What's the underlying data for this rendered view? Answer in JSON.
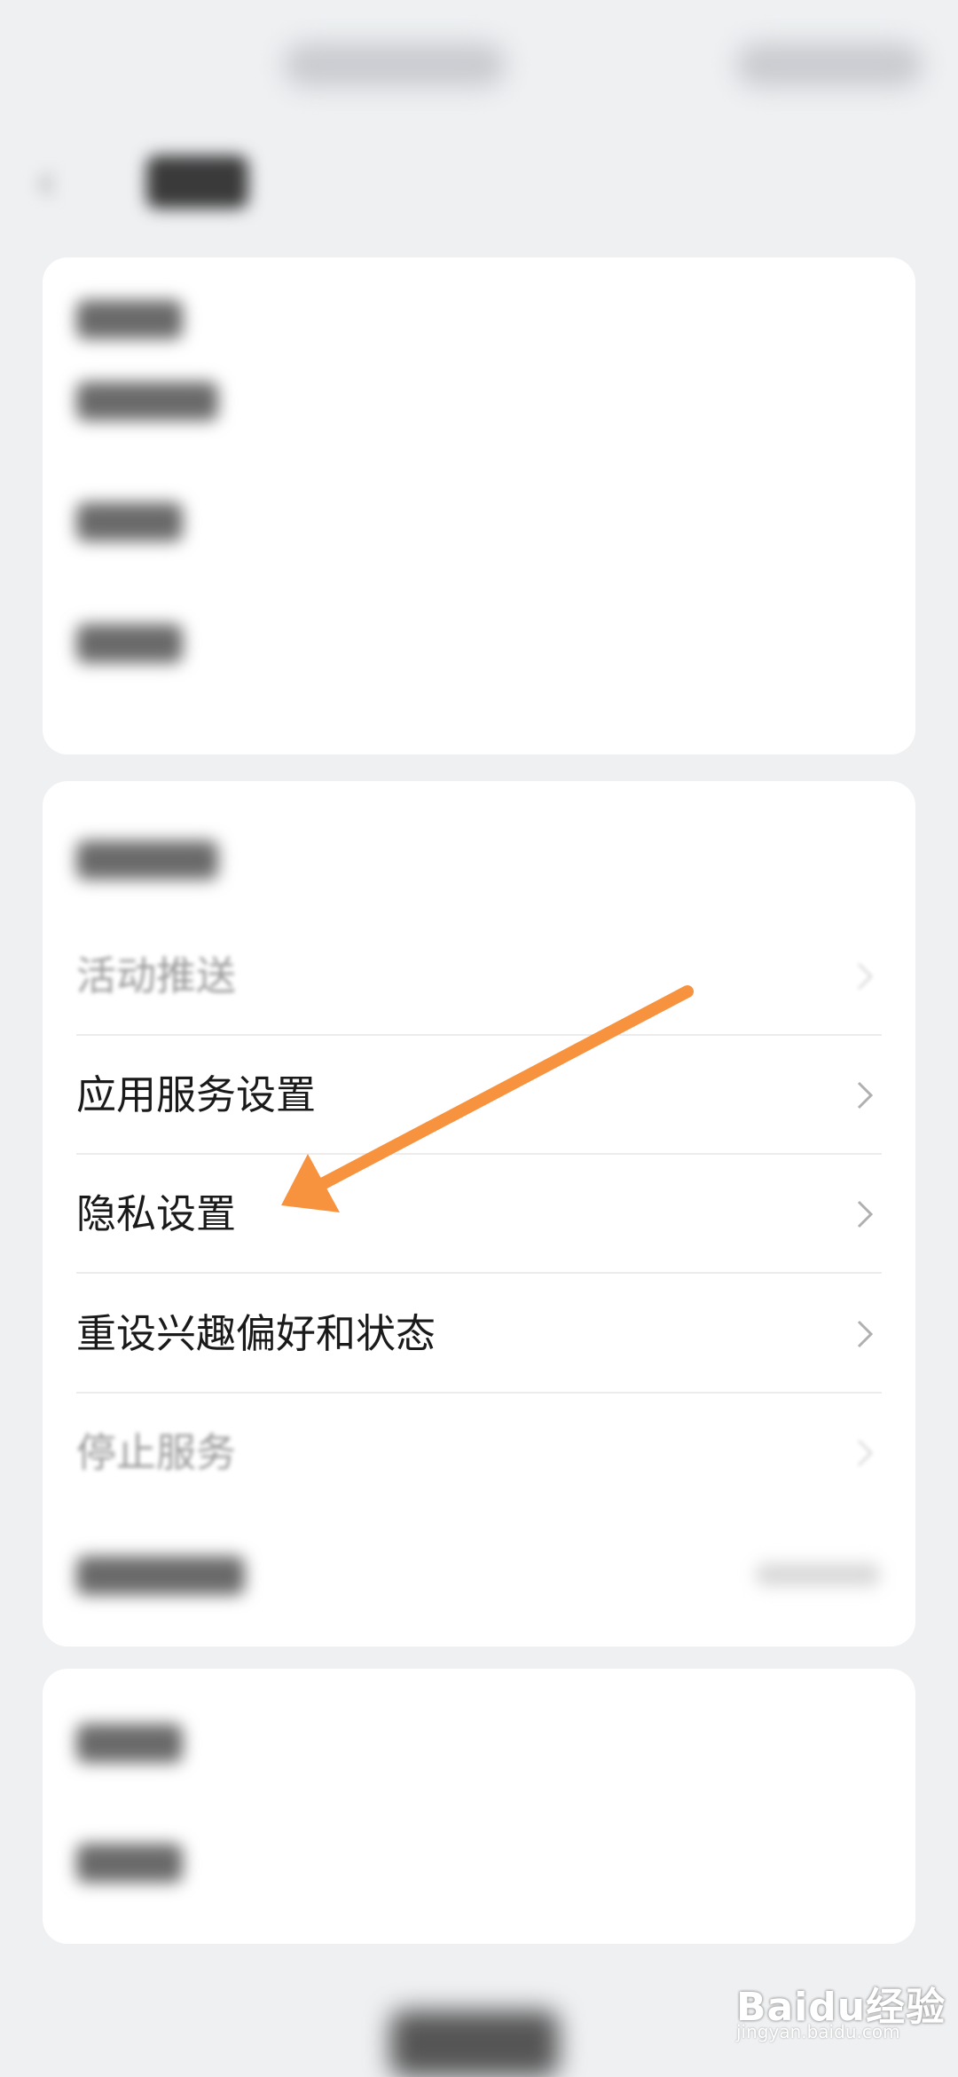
{
  "menu": {
    "items": [
      {
        "label": "活动推送",
        "faded": true
      },
      {
        "label": "应用服务设置",
        "faded": false
      },
      {
        "label": "隐私设置",
        "faded": false
      },
      {
        "label": "重设兴趣偏好和状态",
        "faded": false
      },
      {
        "label": "停止服务",
        "faded": true
      }
    ]
  },
  "watermark": {
    "logo": "Baidu经验",
    "url": "jingyan.baidu.com"
  },
  "colors": {
    "arrow": "#f7923e",
    "background": "#eef0f2",
    "card": "#ffffff"
  }
}
